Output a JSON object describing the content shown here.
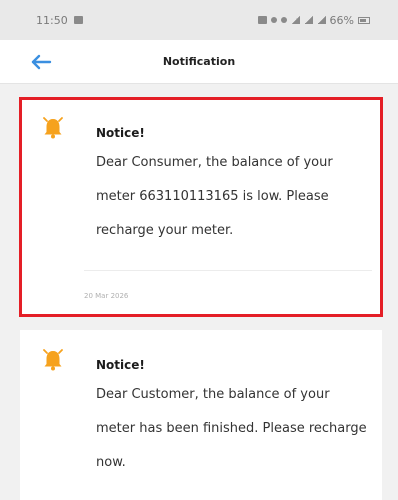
{
  "status_bar": {
    "time": "11:50",
    "battery": "66%"
  },
  "header": {
    "title": "Notification"
  },
  "notifications": [
    {
      "title": "Notice!",
      "body": "Dear Consumer, the balance of your meter 663110113165 is low. Please recharge your meter.",
      "date": "20 Mar 2026"
    },
    {
      "title": "Notice!",
      "body": "Dear Customer, the balance of your meter has been finished. Please recharge now."
    }
  ],
  "colors": {
    "accent": "#3b8fe0",
    "bell": "#f6a21d",
    "highlight": "#e41e26"
  },
  "icons": {
    "back": "arrow-left-icon",
    "notification": "bell-icon"
  }
}
